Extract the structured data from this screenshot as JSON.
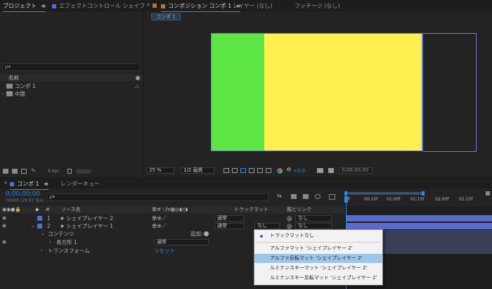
{
  "project_panel": {
    "tab_label": "プロジェクト",
    "menu_icon": "≡",
    "effects_tab_label": "エフェクトコントロール シェイプ",
    "search_placeholder": "ρ▾",
    "column_name": "名前",
    "items": [
      {
        "label": "コンポ 1",
        "icon": "composition-icon"
      },
      {
        "label": "中面",
        "icon": "folder-icon"
      }
    ],
    "bpc_label": "8 bpc"
  },
  "viewer_panel": {
    "comp_tab_label": "コンポジション コンポ 1",
    "comp_menu_icon": "≡",
    "layer_tab_label": "レイヤー (なし)",
    "footage_tab_label": "フッテージ (なし)",
    "breadcrumb": "コンポ 1",
    "zoom": "25 %",
    "resolution": "1/2 画質",
    "exposure": "+0.0",
    "timecode": "0;00;00;00",
    "colors": {
      "yellow": "#fff050",
      "green": "#5de543",
      "dark": "#232323"
    }
  },
  "timeline": {
    "comp_tab_label": "コンポ 1",
    "render_queue_label": "レンダーキュー",
    "timecode": "0;00;00;00",
    "frame_info": "00000 (29.97 fps)",
    "search_placeholder": "ρ▾",
    "col_source": "ソース名",
    "col_switches": "单✲＼fx▦◎◐◑",
    "col_trackmatte": "トラックマット",
    "col_parent": "親とリンク",
    "ruler_labels": [
      "0f",
      "00:15f",
      "01:00f",
      "01:15f",
      "02:00f",
      "02:15f"
    ],
    "layers": [
      {
        "num": "1",
        "name": "★ シェイプレイヤー 2",
        "mode": "通常",
        "matte": "",
        "parent": "なし"
      },
      {
        "num": "2",
        "name": "★ シェイプレイヤー 1",
        "mode": "通常",
        "matte": "なし",
        "parent": "なし"
      }
    ],
    "contents_label": "コンテンツ",
    "add_label": "追加:",
    "rect_label": "長方形 1",
    "rect_mode": "通常",
    "transform_label": "トランスフォーム",
    "reset_label": "リセット"
  },
  "trackmatte_menu": {
    "items": [
      {
        "label": "トラックマットなし",
        "checked": true
      },
      {
        "label": "アルファマット 'シェイプレイヤー 2'",
        "checked": false
      },
      {
        "label": "アルファ反転マット 'シェイプレイヤー 2'",
        "checked": false,
        "highlighted": true
      },
      {
        "label": "ルミナンスキーマット 'シェイプレイヤー 2'",
        "checked": false
      },
      {
        "label": "ルミナンスキー反転マット 'シェイプレイヤー 2'",
        "checked": false
      }
    ]
  }
}
